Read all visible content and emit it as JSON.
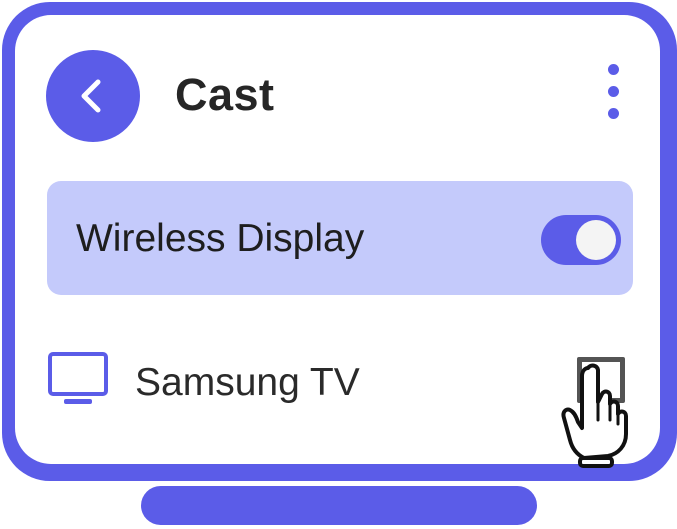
{
  "header": {
    "back_icon": "chevron-left-icon",
    "title": "Cast",
    "menu_icon": "more-vertical-icon"
  },
  "wireless_display": {
    "label": "Wireless Display",
    "enabled": true
  },
  "devices": [
    {
      "icon": "tv-icon",
      "name": "Samsung TV",
      "checked": false
    }
  ],
  "pointer_icon": "hand-pointer-icon",
  "colors": {
    "accent": "#5b5ce8",
    "highlight_row": "#c4cafb",
    "text": "#262626"
  }
}
